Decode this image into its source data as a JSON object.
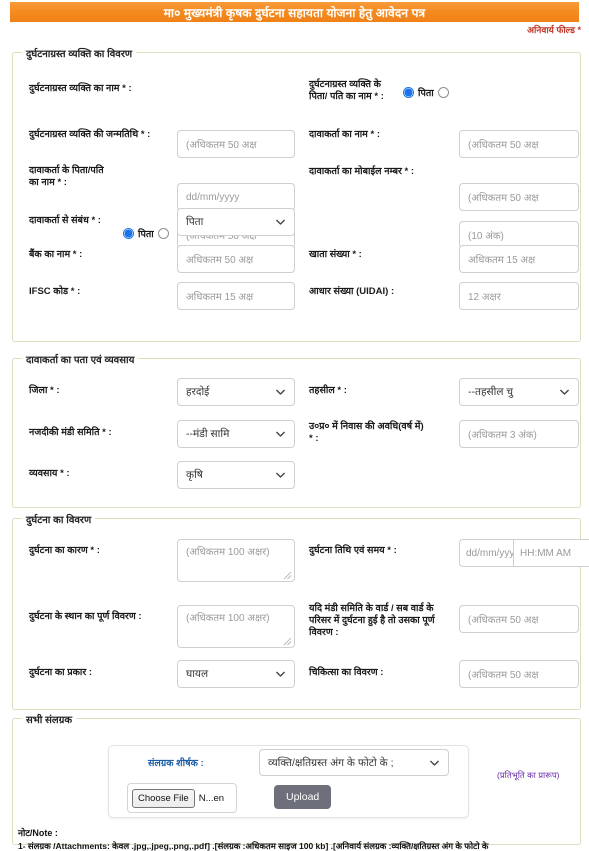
{
  "header": {
    "title": "मा० मुख्यमंत्री कृषक दुर्घटना सहायता योजना हेतु आवेदन पत्र",
    "mandatory_note": "अनिवार्य फील्ड *"
  },
  "section1": {
    "legend": "दुर्घटनाग्रस्त व्यक्ति का विवरण",
    "victim_name_label": "दुर्घटनाग्रस्त व्यक्ति का नाम * :",
    "victim_name_placeholder": "(अधिकतम 50 अक्ष",
    "victim_dob_label": "दुर्घटनाग्रस्त व्यक्ति की जन्मतिथि * :",
    "victim_dob_placeholder": "dd/mm/yyyy",
    "claimant_father_label": "दावाकर्ता के पिता/पति का नाम * :",
    "claimant_father_placeholder": "(अधिकतम 50 अक्ष",
    "claimant_father_radio": "पिता",
    "relation_label": "दावाकर्ता से संबंध * :",
    "relation_value": "पिता",
    "bank_name_label": "बैंक का नाम * :",
    "bank_name_placeholder": "अधिकतम 50 अक्ष",
    "ifsc_label": "IFSC कोड * :",
    "ifsc_placeholder": "अधिकतम 15 अक्ष",
    "victim_father_label": "दुर्घटनाग्रस्त व्यक्ति के पिता/ पति का नाम * :",
    "victim_father_radio": "पिता",
    "victim_father_placeholder": "(अधिकतम 50 अक्ष",
    "claimant_name_label": "दावाकर्ता का नाम * :",
    "claimant_name_placeholder": "(अधिकतम 50 अक्ष",
    "claimant_mobile_label": "दावाकर्ता का मोबाईल नम्बर * :",
    "claimant_mobile_placeholder": "(10 अंक)",
    "account_no_label": "खाता संख्या * :",
    "account_no_placeholder": "अधिकतम 15 अक्ष",
    "aadhaar_label": "आधार संख्या (UIDAI) :",
    "aadhaar_placeholder": "12 अक्षर"
  },
  "section2": {
    "legend": "दावाकर्ता का पता एवं व्यवसाय",
    "district_label": "जिला * :",
    "district_value": "हरदोई",
    "mandi_label": "नजदीकी मंडी समिति * :",
    "mandi_value": "--मंडी सामि",
    "occupation_label": "व्यवसाय * :",
    "occupation_value": "कृषि",
    "tehsil_label": "तहसील * :",
    "tehsil_value": "--तहसील चु",
    "residence_label": "उ०प्र० में निवास की अवधि(वर्ष में) * :",
    "residence_placeholder": "(अधिकतम 3 अंक)"
  },
  "section3": {
    "legend": "दुर्घटना का विवरण",
    "cause_label": "दुर्घटना का कारण * :",
    "cause_placeholder": "(अधिकतम 100 अक्षर)",
    "place_label": "दुर्घटना के स्थान का पूर्ण विवरण :",
    "place_placeholder": "(अधिकतम 100 अक्षर)",
    "type_label": "दुर्घटना का प्रकार :",
    "type_value": "घायल",
    "datetime_label": "दुर्घटना तिथि एवं समय * :",
    "date_placeholder": "dd/mm/yyy",
    "time_placeholder": "HH:MM AM",
    "ward_label": "यदि मंडी समिति के वार्ड / सब वार्ड के परिसर में दुर्घटना हुई है तो उसका पूर्ण विवरण :",
    "ward_placeholder": "(अधिकतम 50 अक्ष",
    "medical_label": "चिकित्सा का विवरण :",
    "medical_placeholder": "(अधिकतम 50 अक्ष"
  },
  "section4": {
    "legend": "सभी संलग्रक",
    "attachment_title_label": "संलग्रक शीर्षक :",
    "attachment_select_value": "व्यक्ति/क्षतिग्रस्त अंग के फोटो के ;",
    "choose_file_label": "Choose File",
    "file_name": "N...en",
    "upload_label": "Upload",
    "format_link": "(प्रतिभूति का प्रारूप)"
  },
  "note": {
    "title": "नोट/Note :",
    "line1": "1- संलग्रक /Attachments: केवल .jpg,.jpeg,.png,.pdf] .[संलग्रक :अधिकतम साइज 100 kb] .[अनिवार्य संलग्रक :व्यक्ति/क्षतिग्रस्त अंग के फोटो के"
  },
  "icons": {
    "caret": "chevron-down-icon"
  },
  "colors": {
    "header_orange": "#f58a1f",
    "accent_blue": "#1a73e8",
    "required_red": "#c0392b",
    "fieldset_border": "#d9e0c0",
    "upload_gray": "#6d707b",
    "link_purple": "#6d2fa8",
    "attach_label_blue": "#1f5fa8"
  }
}
